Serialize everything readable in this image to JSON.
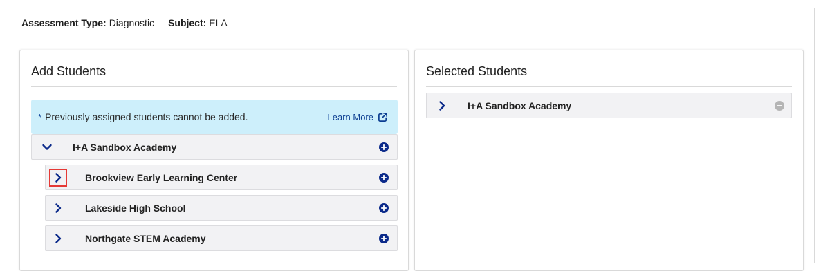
{
  "info": {
    "assessment_type_label": "Assessment Type:",
    "assessment_type_value": "Diagnostic",
    "subject_label": "Subject:",
    "subject_value": "ELA"
  },
  "add_panel": {
    "title": "Add Students",
    "notice": {
      "asterisk": "*",
      "text": "Previously assigned students cannot be added.",
      "link_label": "Learn More"
    },
    "district": "I+A Sandbox Academy",
    "schools": [
      "Brookview Early Learning Center",
      "Lakeside High School",
      "Northgate STEM Academy"
    ]
  },
  "selected_panel": {
    "title": "Selected Students",
    "items": [
      "I+A Sandbox Academy"
    ]
  },
  "colors": {
    "accent": "#0b2a8a",
    "notice_bg": "#cdeffb",
    "row_bg": "#f2f2f4",
    "focus_ring": "#e53935",
    "remove_icon": "#b5b5b5"
  }
}
